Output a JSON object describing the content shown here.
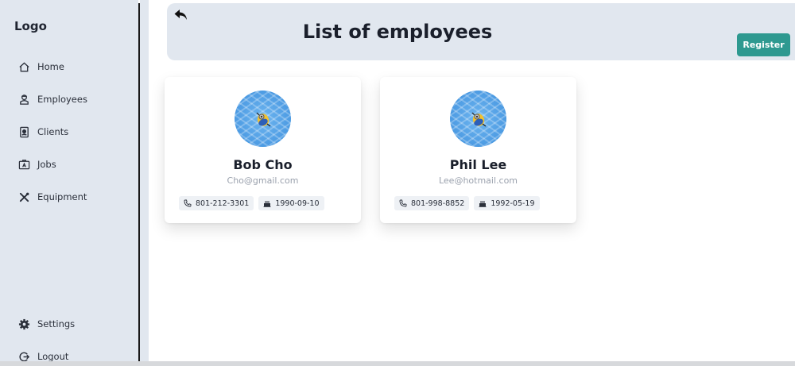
{
  "sidebar": {
    "logo": "Logo",
    "items": [
      {
        "label": "Home",
        "icon": "home-icon"
      },
      {
        "label": "Employees",
        "icon": "employees-icon"
      },
      {
        "label": "Clients",
        "icon": "clients-icon"
      },
      {
        "label": "Jobs",
        "icon": "jobs-icon"
      },
      {
        "label": "Equipment",
        "icon": "equipment-icon"
      }
    ],
    "bottom_items": [
      {
        "label": "Settings",
        "icon": "gear-icon"
      },
      {
        "label": "Logout",
        "icon": "logout-icon"
      }
    ]
  },
  "header": {
    "title": "List of employees",
    "register_label": "Register",
    "back_icon": "back-arrow-icon",
    "accent_color": "#2e9990"
  },
  "employees": [
    {
      "name": "Bob Cho",
      "email": "Cho@gmail.com",
      "phone": "801-212-3301",
      "birthday": "1990-09-10"
    },
    {
      "name": "Phil Lee",
      "email": "Lee@hotmail.com",
      "phone": "801-998-8852",
      "birthday": "1992-05-19"
    }
  ]
}
